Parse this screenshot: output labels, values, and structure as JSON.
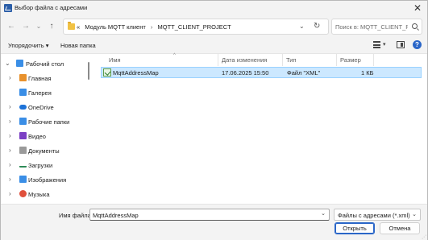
{
  "window": {
    "title": "Выбор файла с адресами"
  },
  "address": {
    "prefix": "«",
    "segments": [
      "Модуль MQTT клиент",
      "MQTT_CLIENT_PROJECT"
    ],
    "separator": "›"
  },
  "search": {
    "placeholder": "Поиск в: MQTT_CLIENT_P..."
  },
  "toolbar": {
    "organize": "Упорядочить ▾",
    "new_folder": "Новая папка"
  },
  "tree": [
    {
      "label": "Рабочий стол",
      "icon": "desktop-icon",
      "color": "#3a8ee6",
      "chevron": "⌄"
    },
    {
      "label": "Главная",
      "icon": "home-icon",
      "color": "#e8912c",
      "chevron": "›"
    },
    {
      "label": "Галерея",
      "icon": "gallery-icon",
      "color": "#3a8ee6",
      "chevron": ""
    },
    {
      "label": "OneDrive",
      "icon": "cloud-icon",
      "color": "#1e73d8",
      "chevron": "›"
    },
    {
      "label": "Рабочие папки",
      "icon": "work-folders-icon",
      "color": "#3a8ee6",
      "chevron": "›"
    },
    {
      "label": "Видео",
      "icon": "video-icon",
      "color": "#7b3fc4",
      "chevron": "›"
    },
    {
      "label": "Документы",
      "icon": "documents-icon",
      "color": "#9a9a9a",
      "chevron": "›"
    },
    {
      "label": "Загрузки",
      "icon": "downloads-icon",
      "color": "#2e8b57",
      "chevron": "›"
    },
    {
      "label": "Изображения",
      "icon": "pictures-icon",
      "color": "#3a8ee6",
      "chevron": "›"
    },
    {
      "label": "Музыка",
      "icon": "music-icon",
      "color": "#e0503c",
      "chevron": "›"
    }
  ],
  "columns": {
    "name": "Имя",
    "date": "Дата изменения",
    "type": "Тип",
    "size": "Размер"
  },
  "files": [
    {
      "name": "MqttAddressMap",
      "date": "17.06.2025 15:50",
      "type": "Файл \"XML\"",
      "size": "1 КБ"
    }
  ],
  "bottom": {
    "filename_label": "Имя файла:",
    "filename_value": "MqttAddressMap",
    "filetype": "Файлы с адресами (*.xml)",
    "open": "Открыть",
    "cancel": "Отмена"
  },
  "colors": {
    "selection": "#cce8ff",
    "accent": "#2a66c8"
  }
}
